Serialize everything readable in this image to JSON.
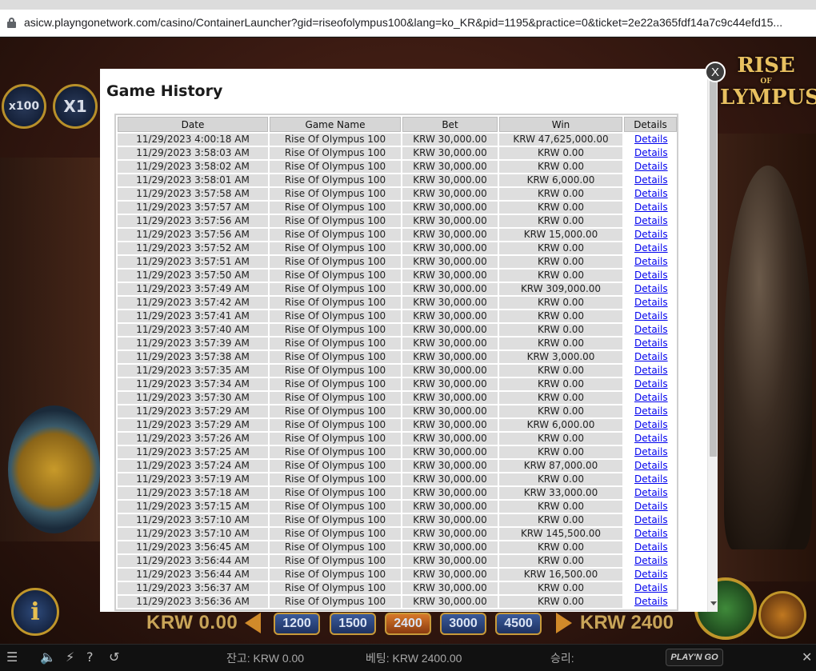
{
  "browser": {
    "url": "asicw.playngonetwork.com/casino/ContainerLauncher?gid=riseofolympus100&lang=ko_KR&pid=1195&practice=0&ticket=2e22a365fdf14a7c9c44efd15..."
  },
  "game": {
    "multipliers": [
      "x100",
      "X1"
    ],
    "logo_line1": "RISE",
    "logo_line2": "OF",
    "logo_line3": "LYMPUS",
    "info_label": "i",
    "balance_display": "KRW 0.00",
    "bet_display": "KRW 2400",
    "bet_options": [
      "1200",
      "1500",
      "2400",
      "3000",
      "4500"
    ],
    "selected_bet": "2400",
    "status": {
      "balance": "잔고: KRW 0.00",
      "bet": "베팅: KRW 2400.00",
      "win": "승리:",
      "brand": "PLAY'N GO"
    }
  },
  "modal": {
    "title": "Game History",
    "close_label": "X",
    "columns": [
      "Date",
      "Game Name",
      "Bet",
      "Win",
      "Details"
    ],
    "rows": [
      {
        "date": "11/29/2023 4:00:18 AM",
        "game": "Rise Of Olympus 100",
        "bet": "KRW 30,000.00",
        "win": "KRW 47,625,000.00",
        "details": "Details"
      },
      {
        "date": "11/29/2023 3:58:03 AM",
        "game": "Rise Of Olympus 100",
        "bet": "KRW 30,000.00",
        "win": "KRW 0.00",
        "details": "Details"
      },
      {
        "date": "11/29/2023 3:58:02 AM",
        "game": "Rise Of Olympus 100",
        "bet": "KRW 30,000.00",
        "win": "KRW 0.00",
        "details": "Details"
      },
      {
        "date": "11/29/2023 3:58:01 AM",
        "game": "Rise Of Olympus 100",
        "bet": "KRW 30,000.00",
        "win": "KRW 6,000.00",
        "details": "Details"
      },
      {
        "date": "11/29/2023 3:57:58 AM",
        "game": "Rise Of Olympus 100",
        "bet": "KRW 30,000.00",
        "win": "KRW 0.00",
        "details": "Details"
      },
      {
        "date": "11/29/2023 3:57:57 AM",
        "game": "Rise Of Olympus 100",
        "bet": "KRW 30,000.00",
        "win": "KRW 0.00",
        "details": "Details"
      },
      {
        "date": "11/29/2023 3:57:56 AM",
        "game": "Rise Of Olympus 100",
        "bet": "KRW 30,000.00",
        "win": "KRW 0.00",
        "details": "Details"
      },
      {
        "date": "11/29/2023 3:57:56 AM",
        "game": "Rise Of Olympus 100",
        "bet": "KRW 30,000.00",
        "win": "KRW 15,000.00",
        "details": "Details"
      },
      {
        "date": "11/29/2023 3:57:52 AM",
        "game": "Rise Of Olympus 100",
        "bet": "KRW 30,000.00",
        "win": "KRW 0.00",
        "details": "Details"
      },
      {
        "date": "11/29/2023 3:57:51 AM",
        "game": "Rise Of Olympus 100",
        "bet": "KRW 30,000.00",
        "win": "KRW 0.00",
        "details": "Details"
      },
      {
        "date": "11/29/2023 3:57:50 AM",
        "game": "Rise Of Olympus 100",
        "bet": "KRW 30,000.00",
        "win": "KRW 0.00",
        "details": "Details"
      },
      {
        "date": "11/29/2023 3:57:49 AM",
        "game": "Rise Of Olympus 100",
        "bet": "KRW 30,000.00",
        "win": "KRW 309,000.00",
        "details": "Details"
      },
      {
        "date": "11/29/2023 3:57:42 AM",
        "game": "Rise Of Olympus 100",
        "bet": "KRW 30,000.00",
        "win": "KRW 0.00",
        "details": "Details"
      },
      {
        "date": "11/29/2023 3:57:41 AM",
        "game": "Rise Of Olympus 100",
        "bet": "KRW 30,000.00",
        "win": "KRW 0.00",
        "details": "Details"
      },
      {
        "date": "11/29/2023 3:57:40 AM",
        "game": "Rise Of Olympus 100",
        "bet": "KRW 30,000.00",
        "win": "KRW 0.00",
        "details": "Details"
      },
      {
        "date": "11/29/2023 3:57:39 AM",
        "game": "Rise Of Olympus 100",
        "bet": "KRW 30,000.00",
        "win": "KRW 0.00",
        "details": "Details"
      },
      {
        "date": "11/29/2023 3:57:38 AM",
        "game": "Rise Of Olympus 100",
        "bet": "KRW 30,000.00",
        "win": "KRW 3,000.00",
        "details": "Details"
      },
      {
        "date": "11/29/2023 3:57:35 AM",
        "game": "Rise Of Olympus 100",
        "bet": "KRW 30,000.00",
        "win": "KRW 0.00",
        "details": "Details"
      },
      {
        "date": "11/29/2023 3:57:34 AM",
        "game": "Rise Of Olympus 100",
        "bet": "KRW 30,000.00",
        "win": "KRW 0.00",
        "details": "Details"
      },
      {
        "date": "11/29/2023 3:57:30 AM",
        "game": "Rise Of Olympus 100",
        "bet": "KRW 30,000.00",
        "win": "KRW 0.00",
        "details": "Details"
      },
      {
        "date": "11/29/2023 3:57:29 AM",
        "game": "Rise Of Olympus 100",
        "bet": "KRW 30,000.00",
        "win": "KRW 0.00",
        "details": "Details"
      },
      {
        "date": "11/29/2023 3:57:29 AM",
        "game": "Rise Of Olympus 100",
        "bet": "KRW 30,000.00",
        "win": "KRW 6,000.00",
        "details": "Details"
      },
      {
        "date": "11/29/2023 3:57:26 AM",
        "game": "Rise Of Olympus 100",
        "bet": "KRW 30,000.00",
        "win": "KRW 0.00",
        "details": "Details"
      },
      {
        "date": "11/29/2023 3:57:25 AM",
        "game": "Rise Of Olympus 100",
        "bet": "KRW 30,000.00",
        "win": "KRW 0.00",
        "details": "Details"
      },
      {
        "date": "11/29/2023 3:57:24 AM",
        "game": "Rise Of Olympus 100",
        "bet": "KRW 30,000.00",
        "win": "KRW 87,000.00",
        "details": "Details"
      },
      {
        "date": "11/29/2023 3:57:19 AM",
        "game": "Rise Of Olympus 100",
        "bet": "KRW 30,000.00",
        "win": "KRW 0.00",
        "details": "Details"
      },
      {
        "date": "11/29/2023 3:57:18 AM",
        "game": "Rise Of Olympus 100",
        "bet": "KRW 30,000.00",
        "win": "KRW 33,000.00",
        "details": "Details"
      },
      {
        "date": "11/29/2023 3:57:15 AM",
        "game": "Rise Of Olympus 100",
        "bet": "KRW 30,000.00",
        "win": "KRW 0.00",
        "details": "Details"
      },
      {
        "date": "11/29/2023 3:57:10 AM",
        "game": "Rise Of Olympus 100",
        "bet": "KRW 30,000.00",
        "win": "KRW 0.00",
        "details": "Details"
      },
      {
        "date": "11/29/2023 3:57:10 AM",
        "game": "Rise Of Olympus 100",
        "bet": "KRW 30,000.00",
        "win": "KRW 145,500.00",
        "details": "Details"
      },
      {
        "date": "11/29/2023 3:56:45 AM",
        "game": "Rise Of Olympus 100",
        "bet": "KRW 30,000.00",
        "win": "KRW 0.00",
        "details": "Details"
      },
      {
        "date": "11/29/2023 3:56:44 AM",
        "game": "Rise Of Olympus 100",
        "bet": "KRW 30,000.00",
        "win": "KRW 0.00",
        "details": "Details"
      },
      {
        "date": "11/29/2023 3:56:44 AM",
        "game": "Rise Of Olympus 100",
        "bet": "KRW 30,000.00",
        "win": "KRW 16,500.00",
        "details": "Details"
      },
      {
        "date": "11/29/2023 3:56:37 AM",
        "game": "Rise Of Olympus 100",
        "bet": "KRW 30,000.00",
        "win": "KRW 0.00",
        "details": "Details"
      },
      {
        "date": "11/29/2023 3:56:36 AM",
        "game": "Rise Of Olympus 100",
        "bet": "KRW 30,000.00",
        "win": "KRW 0.00",
        "details": "Details"
      }
    ]
  }
}
